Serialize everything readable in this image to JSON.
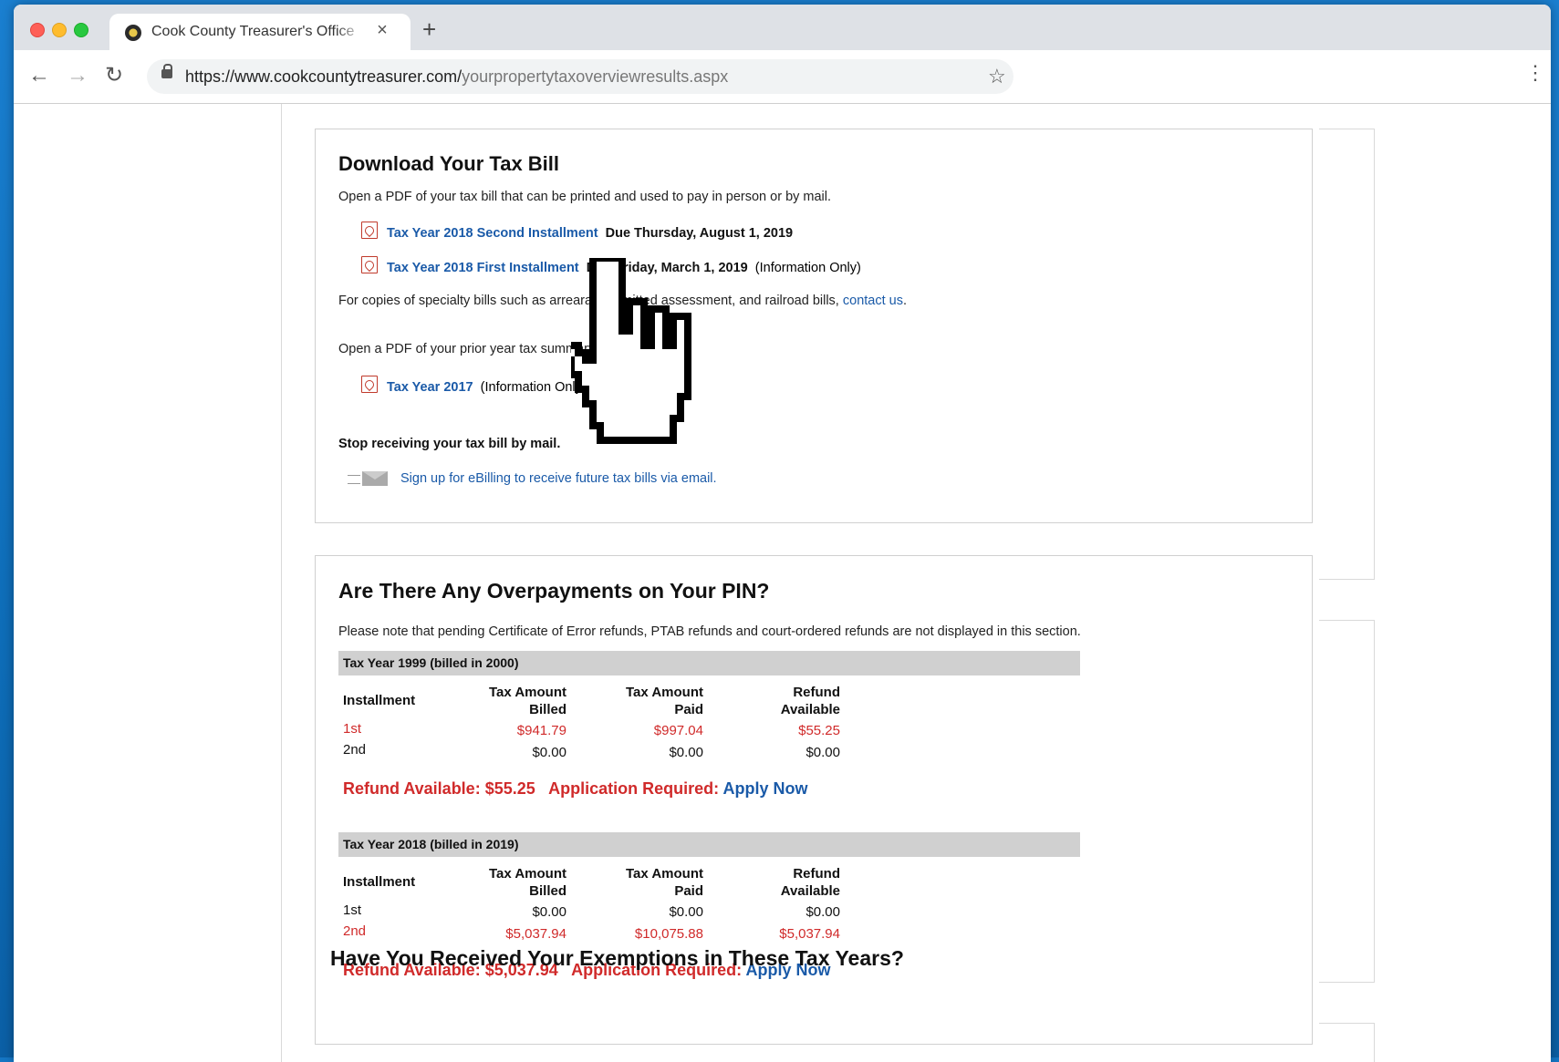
{
  "browser": {
    "tab_title": "Cook County Treasurer's Office",
    "tab_close": "×",
    "new_tab": "+",
    "url_host": "https://www.cookcountytreasurer.com/",
    "url_path": "yourpropertytaxoverviewresults.aspx"
  },
  "icons": [
    "favicon-icon",
    "back-arrow-icon",
    "forward-arrow-icon",
    "reload-icon",
    "lock-icon",
    "star-icon",
    "menu-dots-icon",
    "pdf-icon",
    "email-icon",
    "hand-cursor-icon"
  ],
  "download": {
    "heading": "Download Your Tax Bill",
    "intro": "Open a PDF of your tax bill that can be printed and used to pay in person or by mail.",
    "bills": [
      {
        "link": "Tax Year 2018 Second Installment",
        "due": "Due Thursday, August 1, 2019",
        "note": ""
      },
      {
        "link": "Tax Year 2018 First Installment",
        "due": "Due Friday, March 1, 2019",
        "note": "(Information Only)"
      }
    ],
    "specialty_prefix": "For copies of specialty bills such as arrearage, omitted assessment, and railroad bills,",
    "contact_link": "contact us",
    "prior_intro": "Open a PDF of your prior year tax summary bill.",
    "prior": {
      "link": "Tax Year 2017",
      "note": "(Information Only)"
    },
    "stop_heading": "Stop receiving your tax bill by mail.",
    "ebilling_link": "Sign up for eBilling to receive future tax bills via email."
  },
  "overpayments": {
    "heading": "Are There Any Overpayments on Your PIN?",
    "note": "Please note that pending Certificate of Error refunds, PTAB refunds and court-ordered refunds are not displayed in this section.",
    "headers": {
      "installment": "Installment",
      "billed_1": "Tax Amount",
      "billed_2": "Billed",
      "paid_1": "Tax Amount",
      "paid_2": "Paid",
      "refund_1": "Refund",
      "refund_2": "Available"
    },
    "years": [
      {
        "label": "Tax Year 1999 (billed in 2000)",
        "rows": [
          {
            "inst": "1st",
            "billed": "$941.79",
            "paid": "$997.04",
            "refund": "$55.25",
            "highlight": true
          },
          {
            "inst": "2nd",
            "billed": "$0.00",
            "paid": "$0.00",
            "refund": "$0.00",
            "highlight": false
          }
        ],
        "refund_text": "Refund Available: $55.25",
        "app_text": "Application Required:",
        "apply": "Apply Now"
      },
      {
        "label": "Tax Year 2018 (billed in 2019)",
        "rows": [
          {
            "inst": "1st",
            "billed": "$0.00",
            "paid": "$0.00",
            "refund": "$0.00",
            "highlight": false
          },
          {
            "inst": "2nd",
            "billed": "$5,037.94",
            "paid": "$10,075.88",
            "refund": "$5,037.94",
            "highlight": true
          }
        ],
        "refund_text": "Refund Available: $5,037.94",
        "app_text": "Application Required:",
        "apply": "Apply Now"
      }
    ]
  },
  "next_heading": "Have You Received Your Exemptions in These Tax Years?",
  "colors": {
    "link": "#1a5aa8",
    "refund_red": "#d02a2a",
    "year_bar": "#d0d0d0"
  }
}
